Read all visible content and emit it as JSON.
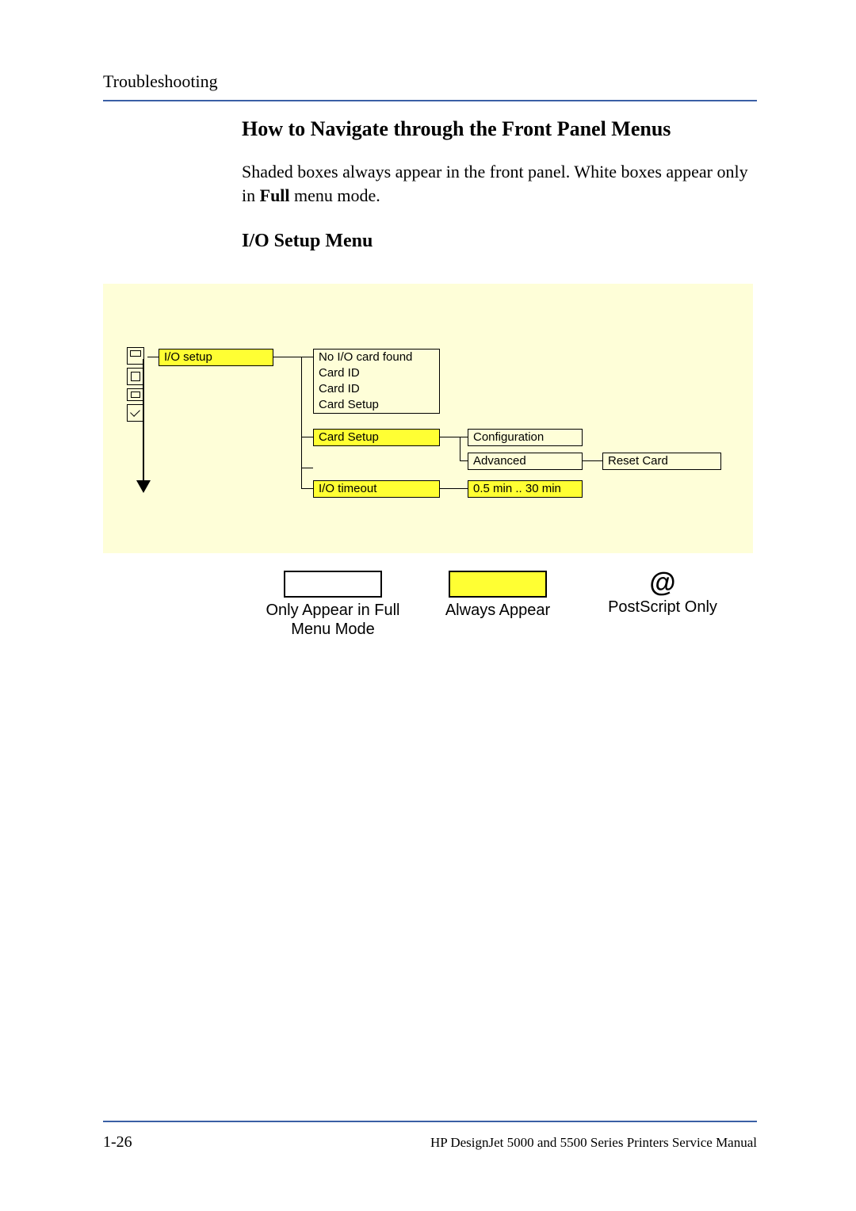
{
  "header": {
    "section": "Troubleshooting"
  },
  "headings": {
    "h2": "How to Navigate through the Front Panel Menus",
    "h3": "I/O Setup Menu"
  },
  "body": {
    "para_prefix": "Shaded boxes always appear in the front panel. White boxes appear only in ",
    "para_bold": "Full",
    "para_suffix": " menu mode."
  },
  "diagram": {
    "root": "I/O setup",
    "level1": {
      "l1a": "No I/O card found",
      "l1b": "Card ID",
      "l1c": "Card ID",
      "l1d": "Card Setup",
      "l1e": "Card Setup",
      "l1f": "I/O timeout"
    },
    "level2": {
      "config": "Configuration",
      "advanced": "Advanced",
      "timeout_range": "0.5 min .. 30 min"
    },
    "level3": {
      "reset": "Reset Card"
    }
  },
  "legend": {
    "white": "Only Appear in Full Menu Mode",
    "yellow": "Always Appear",
    "ps": "PostScript Only",
    "at": "@"
  },
  "footer": {
    "page": "1-26",
    "title": "HP DesignJet 5000 and 5500 Series Printers Service Manual"
  }
}
